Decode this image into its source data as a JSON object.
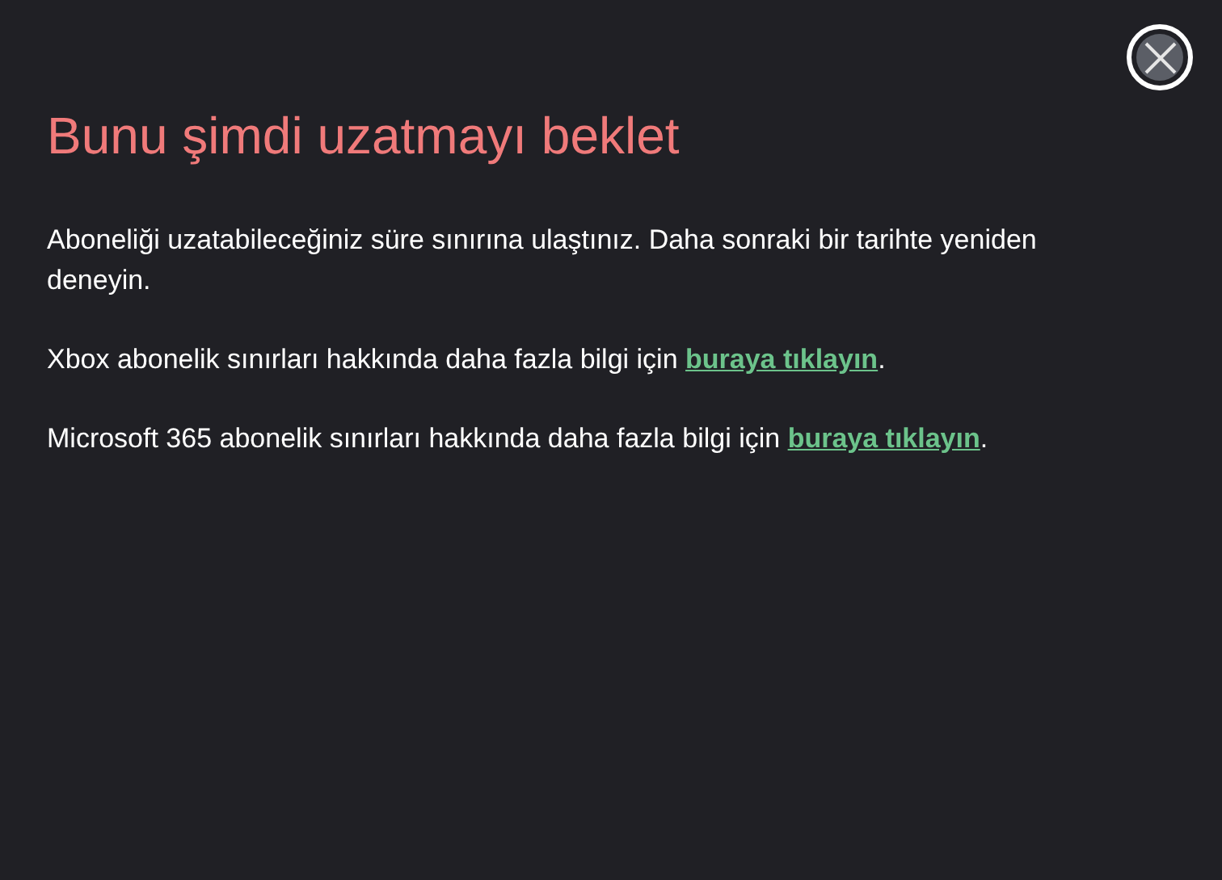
{
  "title": "Bunu şimdi uzatmayı beklet",
  "paragraphs": [
    {
      "text": "Aboneliği uzatabileceğiniz süre sınırına ulaştınız. Daha sonraki bir tarihte yeniden deneyin."
    },
    {
      "text": "Xbox abonelik sınırları hakkında daha fazla bilgi için ",
      "link": "buraya tıklayın",
      "suffix": "."
    },
    {
      "text": "Microsoft 365 abonelik sınırları hakkında daha fazla bilgi için ",
      "link": "buraya tıklayın",
      "suffix": "."
    }
  ]
}
